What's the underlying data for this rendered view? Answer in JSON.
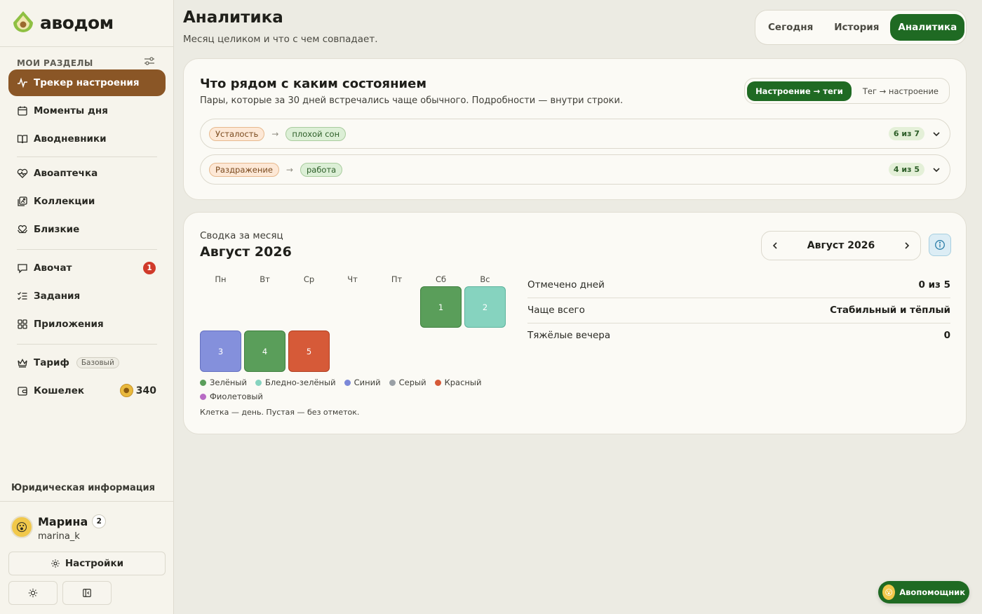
{
  "app": {
    "brand": "аводом",
    "accent": "#1f6a23",
    "sidebar_active": "#8a5626"
  },
  "sidebar": {
    "section_title": "МОИ РАЗДЕЛЫ",
    "items": [
      {
        "label": "Трекер настроения",
        "icon": "pulse-icon",
        "active": true
      },
      {
        "label": "Моменты дня",
        "icon": "calendar-icon"
      },
      {
        "label": "Аводневники",
        "icon": "book-icon"
      },
      {
        "label": "Авоаптечка",
        "icon": "heart-pulse-icon"
      },
      {
        "label": "Коллекции",
        "icon": "gallery-icon"
      },
      {
        "label": "Близкие",
        "icon": "heart-hands-icon"
      },
      {
        "label": "Авочат",
        "icon": "chat-icon",
        "badge": "1"
      },
      {
        "label": "Задания",
        "icon": "checklist-icon"
      },
      {
        "label": "Приложения",
        "icon": "grid-icon"
      },
      {
        "label": "Тариф",
        "icon": "crown-icon",
        "chip": "Базовый"
      },
      {
        "label": "Кошелек",
        "icon": "wallet-icon",
        "coins": "340"
      }
    ],
    "legal": "Юридическая информация",
    "user": {
      "name": "Марина",
      "level": "2",
      "handle": "marina_k"
    },
    "settings_label": "Настройки"
  },
  "header": {
    "title": "Аналитика",
    "subtitle": "Месяц целиком и что с чем совпадает.",
    "tabs": [
      {
        "label": "Сегодня"
      },
      {
        "label": "История"
      },
      {
        "label": "Аналитика",
        "active": true
      }
    ]
  },
  "pairs": {
    "title": "Что рядом с каким состоянием",
    "subtitle": "Пары, которые за 30 дней встречались чаще обычного. Подробности — внутри строки.",
    "toggle": [
      {
        "label": "Настроение → теги",
        "active": true
      },
      {
        "label": "Тег → настроение"
      }
    ],
    "rows": [
      {
        "mood": "Усталость",
        "tag": "плохой сон",
        "count": "6 из 7"
      },
      {
        "mood": "Раздражение",
        "tag": "работа",
        "count": "4 из 5"
      }
    ]
  },
  "summary": {
    "label": "Сводка за месяц",
    "title": "Август 2026",
    "month_nav": "Август 2026",
    "weekdays": [
      "Пн",
      "Вт",
      "Ср",
      "Чт",
      "Пт",
      "Сб",
      "Вс"
    ],
    "days": [
      {
        "num": "1",
        "color": "#5a9e5a",
        "border": "#3f7f3f"
      },
      {
        "num": "2",
        "color": "#86d3bf",
        "border": "#5cb39d"
      },
      {
        "num": "3",
        "color": "#8490dc",
        "border": "#6470c0"
      },
      {
        "num": "4",
        "color": "#5a9e5a",
        "border": "#3f7f3f"
      },
      {
        "num": "5",
        "color": "#d65a38",
        "border": "#b13f20"
      }
    ],
    "legend": [
      {
        "label": "Зелёный",
        "color": "#5a9e5a"
      },
      {
        "label": "Бледно-зелёный",
        "color": "#86d3bf"
      },
      {
        "label": "Синий",
        "color": "#7b88d8"
      },
      {
        "label": "Серый",
        "color": "#9aa0a6"
      },
      {
        "label": "Красный",
        "color": "#d65a38"
      },
      {
        "label": "Фиолетовый",
        "color": "#b86bc4"
      }
    ],
    "note": "Клетка — день. Пустая — без отметок.",
    "stats": [
      {
        "label": "Отмечено дней",
        "value": "0 из 5"
      },
      {
        "label": "Чаще всего",
        "value": "Стабильный и тёплый"
      },
      {
        "label": "Тяжёлые вечера",
        "value": "0"
      }
    ]
  },
  "assistant": {
    "label": "Авопомощник"
  }
}
